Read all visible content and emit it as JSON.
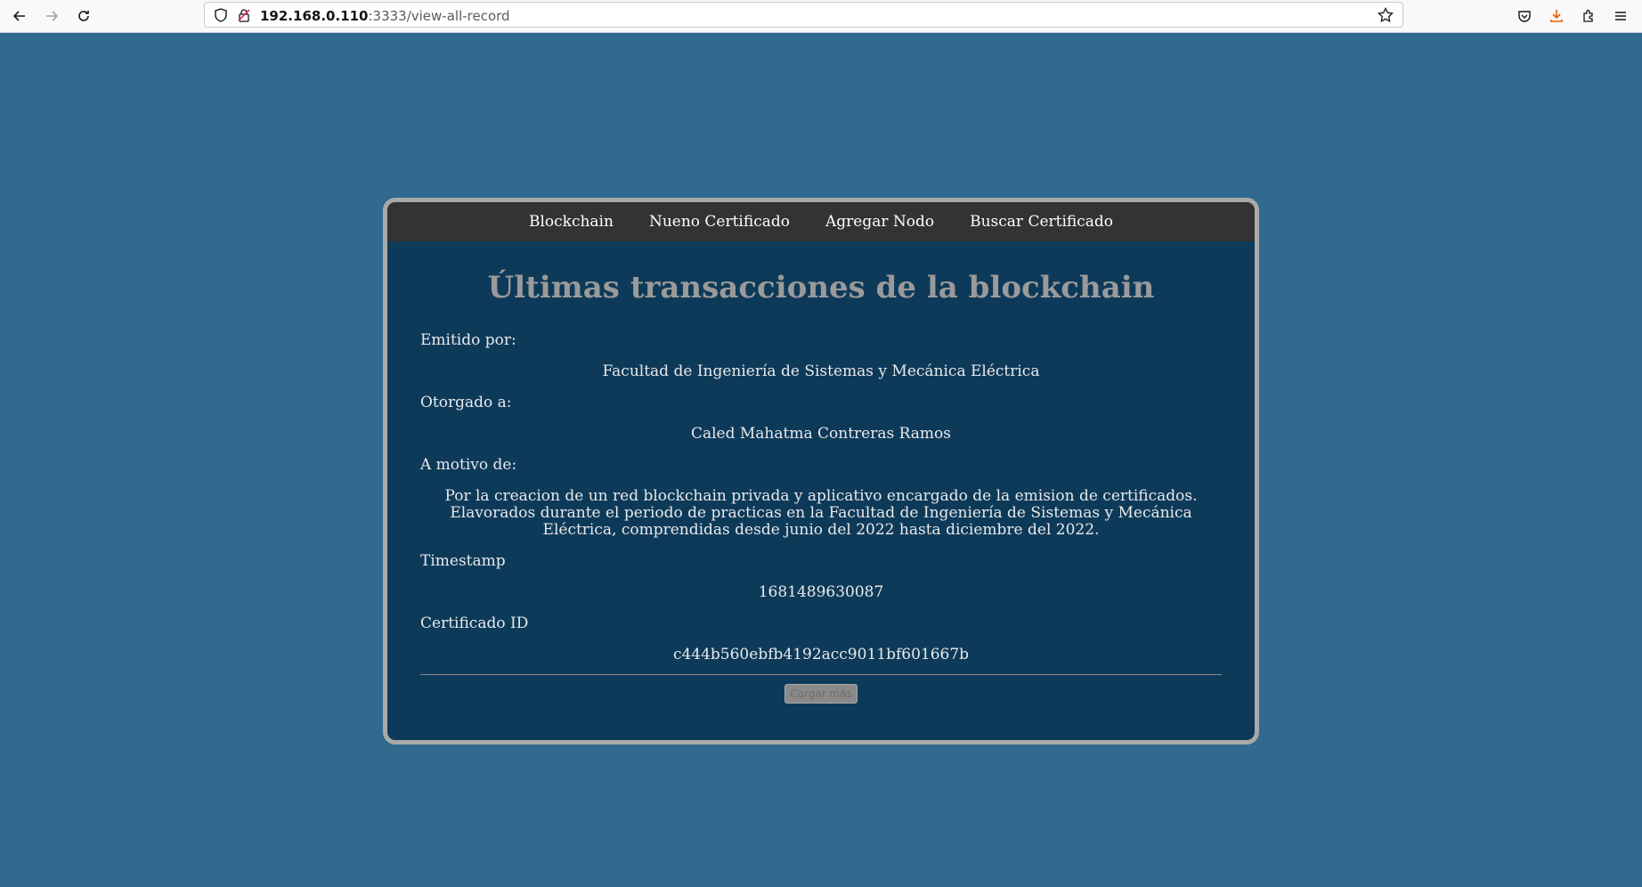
{
  "browser": {
    "url_host": "192.168.0.110",
    "url_rest": ":3333/view-all-record"
  },
  "nav": {
    "items": [
      "Blockchain",
      "Nueno Certificado",
      "Agregar Nodo",
      "Buscar Certificado"
    ]
  },
  "page": {
    "title": "Últimas transacciones de la blockchain"
  },
  "record": {
    "issued_by_label": "Emitido por:",
    "issued_by": "Facultad de Ingeniería de Sistemas y Mecánica Eléctrica",
    "granted_to_label": "Otorgado a:",
    "granted_to": "Caled Mahatma Contreras Ramos",
    "reason_label": "A motivo de:",
    "reason": "Por la creacion de un red blockchain privada y aplicativo encargado de la emision de certificados. Elavorados durante el periodo de practicas en la Facultad de Ingeniería de Sistemas y Mecánica Eléctrica, comprendidas desde junio del 2022 hasta diciembre del 2022.",
    "timestamp_label": "Timestamp",
    "timestamp": "1681489630087",
    "cert_id_label": "Certificado ID",
    "cert_id": "c444b560ebfb4192acc9011bf601667b"
  },
  "load_more_label": "Cargar más"
}
